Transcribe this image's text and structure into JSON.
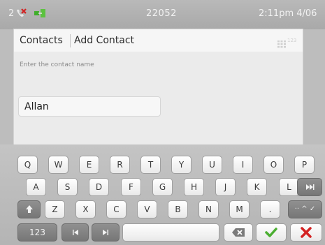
{
  "status_bar": {
    "missed_count": "2",
    "extension": "22052",
    "time": "2:11pm 4/06"
  },
  "tabs": {
    "contacts": "Contacts",
    "add_contact": "Add Contact"
  },
  "grid_label": "123",
  "form": {
    "prompt": "Enter the contact name",
    "name_value": "Allan"
  },
  "keyboard": {
    "row1": [
      "Q",
      "W",
      "E",
      "R",
      "T",
      "Y",
      "U",
      "I",
      "O",
      "P"
    ],
    "row2": [
      "A",
      "S",
      "D",
      "F",
      "G",
      "H",
      "J",
      "K",
      "L"
    ],
    "row3": [
      "Z",
      "X",
      "C",
      "V",
      "B",
      "N",
      "M",
      "."
    ],
    "symbols_key": "·· ^ ✓",
    "numbers_key": "123",
    "colors": {
      "accept": "#4caf32",
      "cancel": "#d32222"
    }
  }
}
